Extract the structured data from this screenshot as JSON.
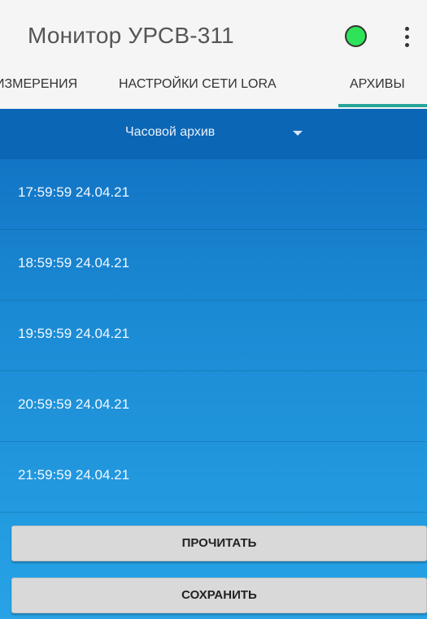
{
  "app": {
    "title": "Монитор УРСВ-311",
    "status_color": "#2ee35a"
  },
  "tabs": [
    {
      "label": "ИЗМЕРЕНИЯ"
    },
    {
      "label": "НАСТРОЙКИ СЕТИ LORA"
    },
    {
      "label": "АРХИВЫ",
      "active": true
    }
  ],
  "archive": {
    "selected": "Часовой архив",
    "items": [
      "17:59:59 24.04.21",
      "18:59:59 24.04.21",
      "19:59:59 24.04.21",
      "20:59:59 24.04.21",
      "21:59:59 24.04.21"
    ]
  },
  "buttons": {
    "read": "ПРОЧИТАТЬ",
    "save": "СОХРАНИТЬ"
  },
  "colors": {
    "accent": "#26a69a",
    "panel": "#1b8ad4"
  }
}
